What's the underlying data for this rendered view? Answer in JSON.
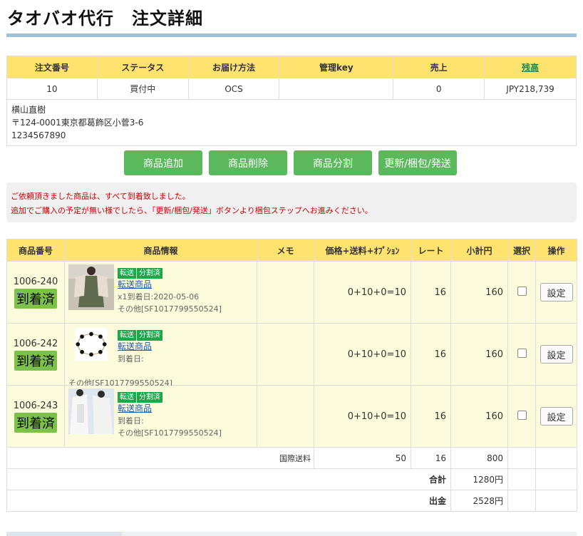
{
  "page": {
    "title": "タオバオ代行　注文詳細"
  },
  "order": {
    "headers": [
      "注文番号",
      "ステータス",
      "お届け方法",
      "管理key",
      "売上",
      "残高"
    ],
    "values": [
      "10",
      "買付中",
      "OCS",
      "",
      "0",
      "JPY218,739"
    ],
    "recipient": {
      "name": "横山直樹",
      "address": "〒124-0001東京都葛飾区小菅3-6",
      "phone": "1234567890"
    }
  },
  "actions": [
    "商品追加",
    "商品削除",
    "商品分割",
    "更新/梱包/発送"
  ],
  "notice": [
    "ご依頼頂きました商品は、すべて到着致しました。",
    "追加でご購入の予定が無い様でしたら、「更新/梱包/発送」ボタンより梱包ステップへお進みください。"
  ],
  "items_table": {
    "headers": [
      "商品番号",
      "商品情報",
      "メモ",
      "価格+送料+ｵﾌﾟｼｮﾝ",
      "レート",
      "小計円",
      "選択",
      "操作"
    ],
    "rows": [
      {
        "id": "1006-240",
        "status": "到着済",
        "tags": [
          "転送",
          "分割済"
        ],
        "link": "転送商品",
        "arrival": "x1到着日:2020-05-06",
        "other": "その他[SF1017799550524]",
        "memo": "",
        "price": "0+10+0=10",
        "rate": "16",
        "subtotal": "160",
        "op": "設定",
        "thumb": "dress"
      },
      {
        "id": "1006-242",
        "status": "到着済",
        "tags": [
          "転送",
          "分割済"
        ],
        "link": "転送商品",
        "arrival": "到着日:",
        "other": "その他[SF1017799550524]",
        "memo": "",
        "price": "0+10+0=10",
        "rate": "16",
        "subtotal": "160",
        "op": "設定",
        "thumb": "necklace"
      },
      {
        "id": "1006-243",
        "status": "到着済",
        "tags": [
          "転送",
          "分割済"
        ],
        "link": "転送商品",
        "arrival": "到着日:",
        "other": "その他[SF1017799550524]",
        "memo": "",
        "price": "0+10+0=10",
        "rate": "16",
        "subtotal": "160",
        "op": "設定",
        "thumb": "cardigan"
      }
    ],
    "shipping": {
      "label": "国際送料",
      "value": "50",
      "rate": "16",
      "subtotal": "800"
    },
    "total": {
      "label": "合計",
      "value": "1280円"
    },
    "payment": {
      "label": "出金",
      "value": "2528円"
    }
  },
  "colors": {
    "header_bg": "#ffe36e",
    "row_bg": "#fcfbdc",
    "button_green": "#5cb85c",
    "arrived_green": "#7cc24a",
    "tag_green": "#1aa84a",
    "notice_red": "#d00000",
    "link_green": "#1a8a4f",
    "title_rule": "#9dc3db"
  }
}
